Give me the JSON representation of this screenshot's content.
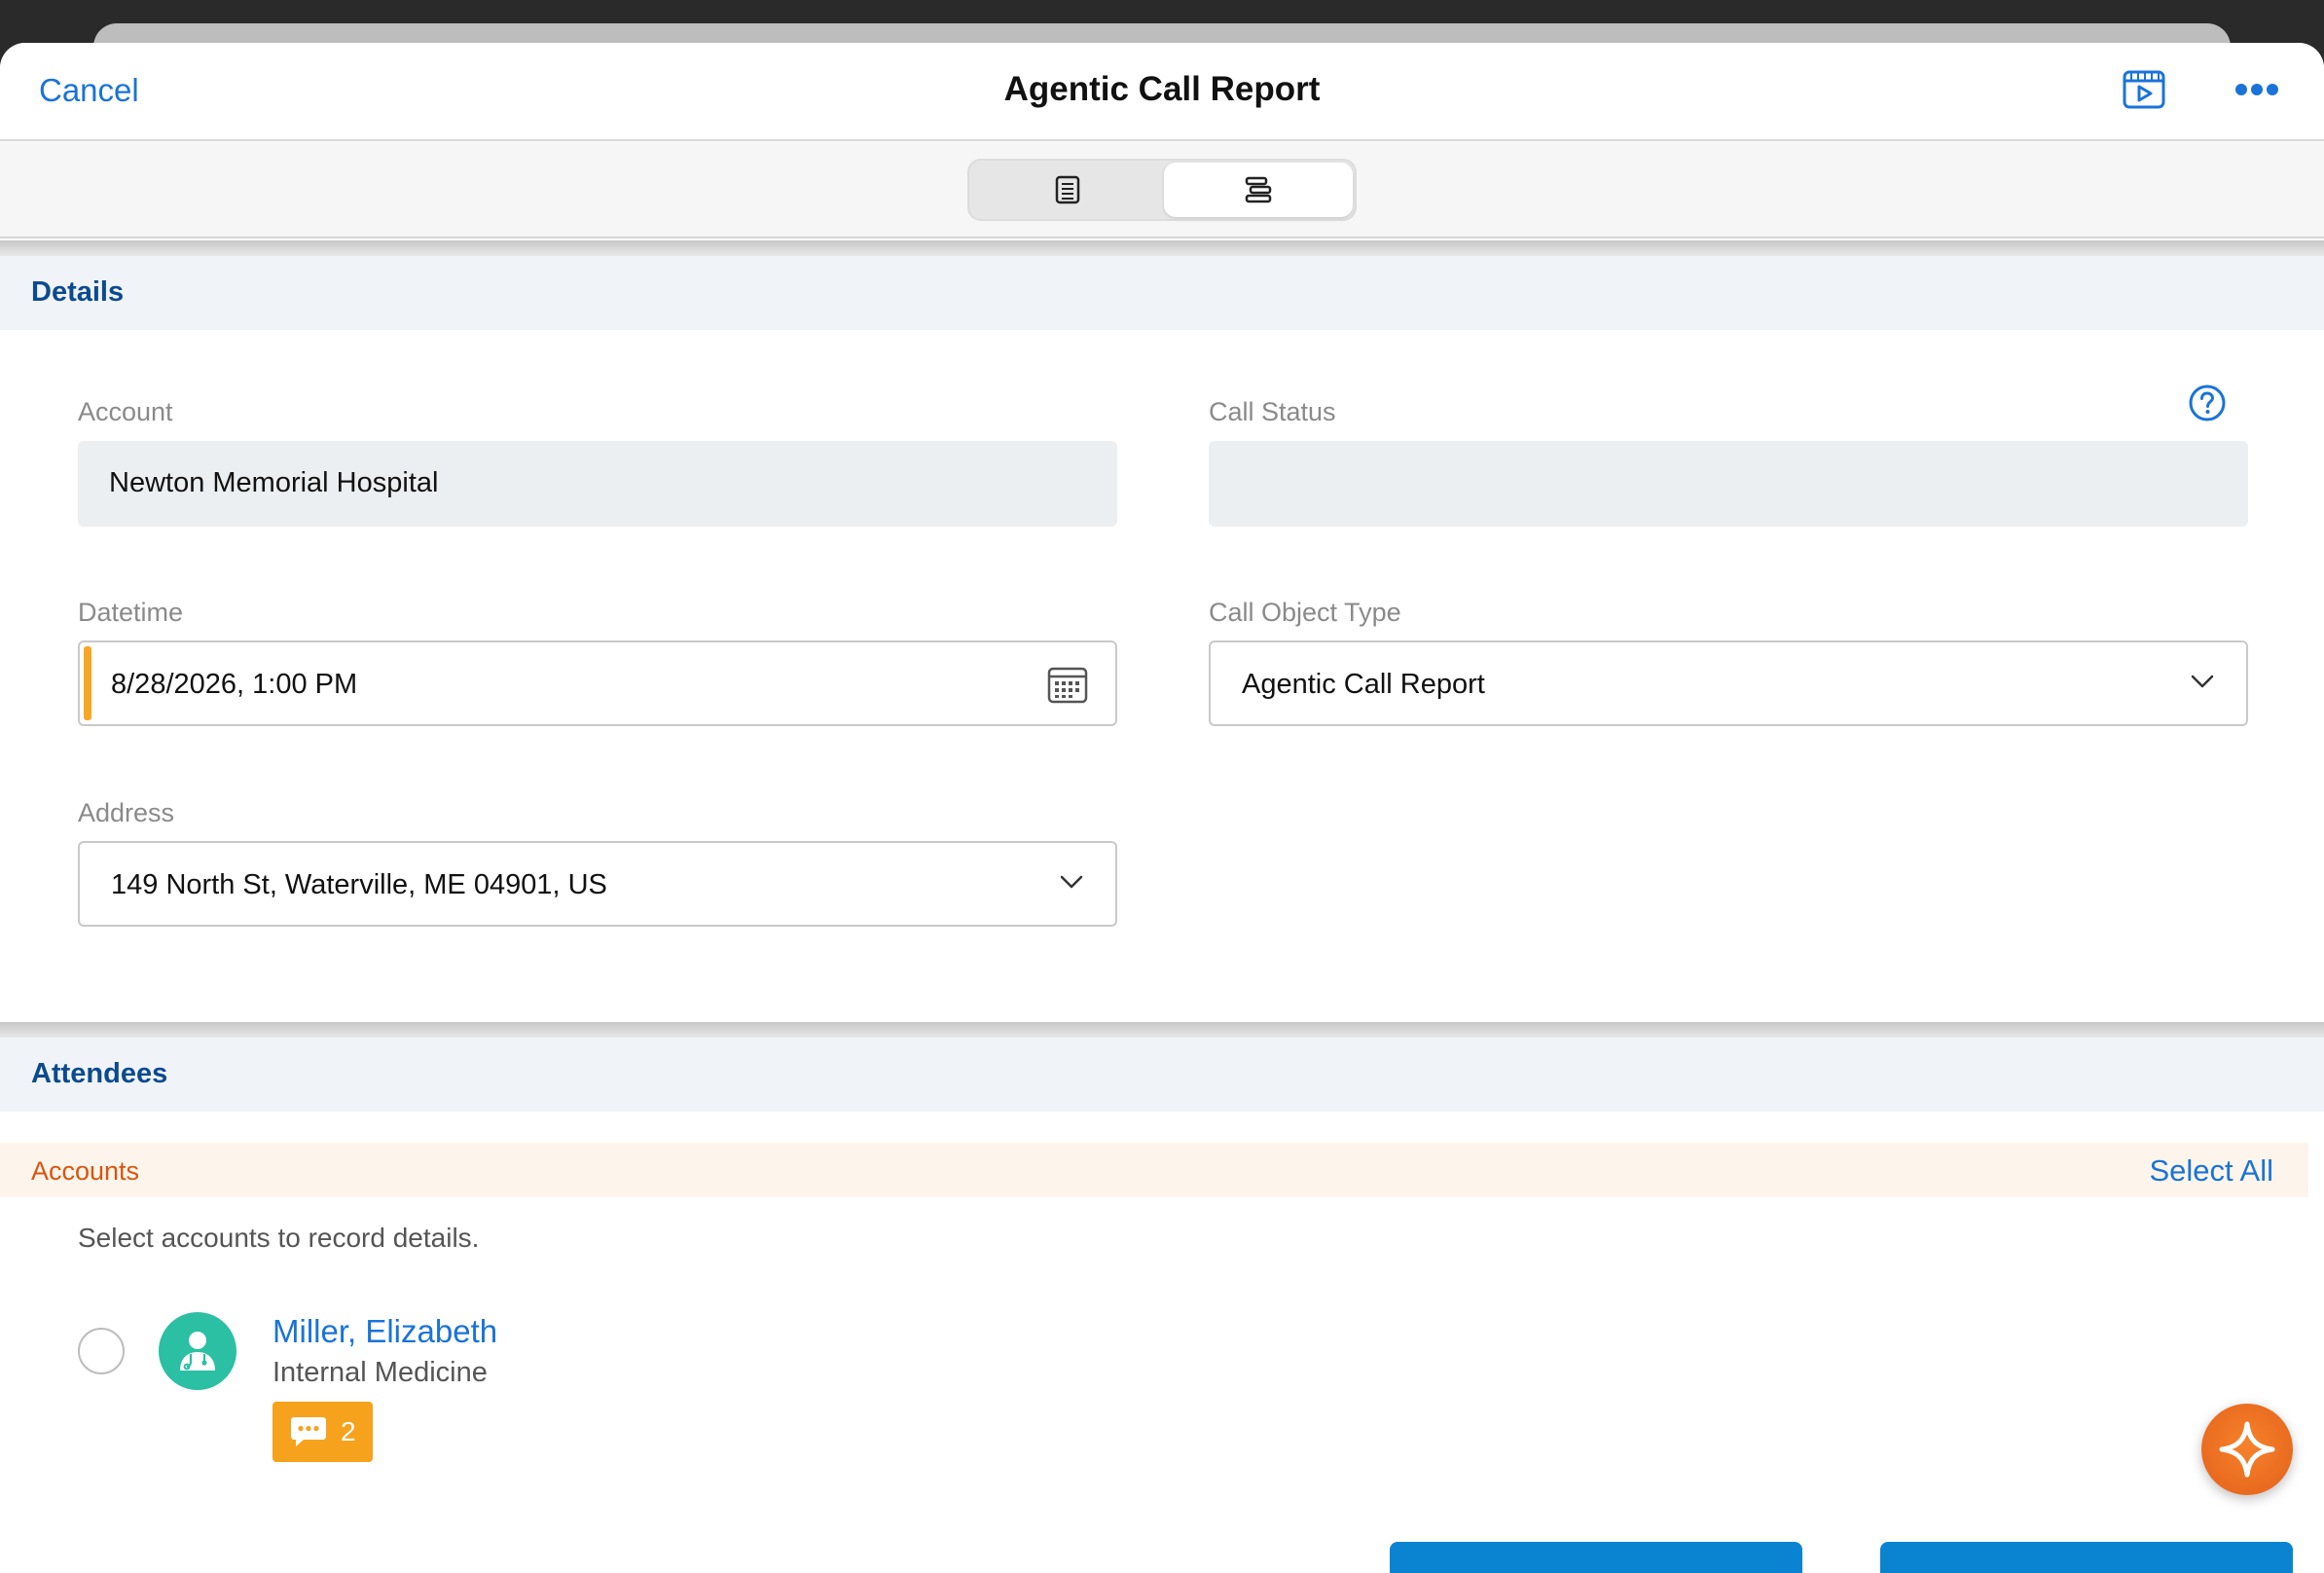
{
  "nav": {
    "cancel_label": "Cancel",
    "title": "Agentic Call Report",
    "media_icon": "media-player-icon",
    "more_icon": "more-horizontal-icon"
  },
  "view_toggle": {
    "left_icon": "document-icon",
    "right_icon": "outline-list-icon",
    "selected": "right"
  },
  "details": {
    "section_title": "Details",
    "account": {
      "label": "Account",
      "value": "Newton Memorial Hospital"
    },
    "call_status": {
      "label": "Call Status",
      "value": ""
    },
    "datetime": {
      "label": "Datetime",
      "value": "8/28/2026, 1:00 PM"
    },
    "call_object_type": {
      "label": "Call Object Type",
      "value": "Agentic Call Report"
    },
    "address": {
      "label": "Address",
      "value": "149 North St, Waterville, ME 04901, US"
    }
  },
  "attendees": {
    "section_title": "Attendees",
    "accounts_title": "Accounts",
    "select_all_label": "Select All",
    "hint": "Select accounts to record details.",
    "items": [
      {
        "name": "Miller, Elizabeth",
        "specialty": "Internal Medicine",
        "comment_count": "2"
      }
    ]
  },
  "colors": {
    "accent_blue": "#1a73d9",
    "section_title": "#0b4a8f",
    "accounts_orange": "#d9540f",
    "required": "#f6a723",
    "badge": "#f6a21c",
    "avatar": "#2bbfa4",
    "fab": "#e3601b"
  }
}
